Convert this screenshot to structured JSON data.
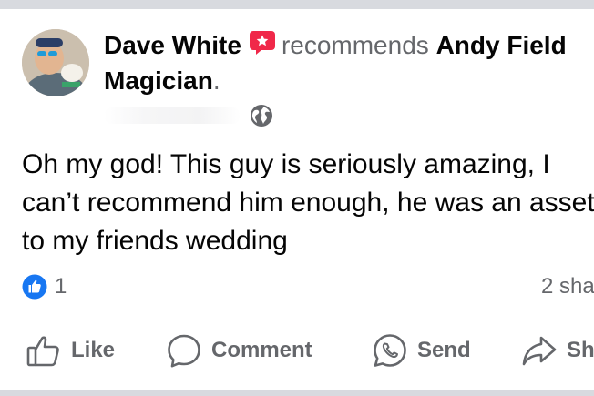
{
  "post": {
    "author": "Dave White",
    "verb": "recommends",
    "page": "Andy Field Magician",
    "period": ".",
    "body": "Oh my god! This guy is seriously amazing, I can’t recommend him enough, he was an asset to my friends wedding",
    "like_count": "1",
    "shares": "2 sha"
  },
  "actions": {
    "like": "Like",
    "comment": "Comment",
    "send": "Send",
    "share": "Sh"
  },
  "colors": {
    "like_blue": "#1877f2",
    "badge_red": "#f02849",
    "secondary_text": "#65676b",
    "divider": "#d8dadf"
  }
}
